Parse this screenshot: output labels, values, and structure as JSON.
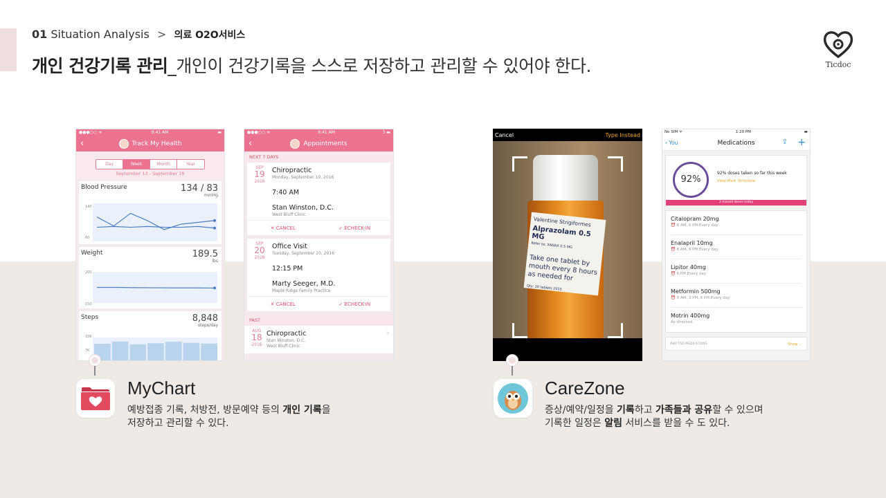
{
  "header": {
    "section_num": "01",
    "section_title": "Situation Analysis",
    "separator": ">",
    "subsection": "의료 O2O서비스",
    "headline_bold": "개인 건강기록 관리",
    "headline_underscore": "_",
    "headline_rest": "개인이 건강기록을 스스로 저장하고 관리할 수 있어야 한다.",
    "logo_text": "Ticdoc"
  },
  "mychart_screen1": {
    "status_left": "●●●○○ ᯤ",
    "status_time": "9:41 AM",
    "status_right": "▬",
    "title": "Track My Health",
    "segments": [
      "Day",
      "Week",
      "Month",
      "Year"
    ],
    "active_segment": 1,
    "range": "September 13 - September 19",
    "cards": [
      {
        "title": "Blood Pressure",
        "value": "134 / 83",
        "unit": "mmHg",
        "axis": [
          "140",
          "60"
        ]
      },
      {
        "title": "Weight",
        "value": "189.5",
        "unit": "lbs",
        "axis": [
          "200",
          "150"
        ]
      },
      {
        "title": "Steps",
        "value": "8,848",
        "unit": "steps/day",
        "axis": [
          "10K",
          "7K"
        ]
      }
    ],
    "bp_series": [
      {
        "name": "systolic",
        "values": [
          140,
          135,
          142,
          138,
          133,
          136,
          137,
          138
        ]
      },
      {
        "name": "diastolic",
        "values": [
          84,
          85,
          84,
          85,
          84,
          84,
          85,
          83
        ]
      }
    ],
    "weight_values": [
      190,
      190,
      189.8,
      189.7,
      189.6,
      189.6,
      189.5
    ],
    "steps_values": [
      8800,
      9600,
      8600,
      9000,
      9500,
      9100,
      8848
    ]
  },
  "mychart_screen2": {
    "status_left": "●●●○○ ᯤ",
    "status_time": "9:41 AM",
    "status_right": "3 ▬",
    "title": "Appointments",
    "next_header": "NEXT 7 DAYS",
    "appointments": [
      {
        "month": "SEP",
        "day": "19",
        "year": "2016",
        "title": "Chiropractic",
        "date": "Monday, September 19, 2016",
        "time": "7:40 AM",
        "doctor": "Stan Winston, D.C.",
        "location": "West Bluff Clinic",
        "cancel": "CANCEL",
        "checkin": "ECHECK-IN"
      },
      {
        "month": "SEP",
        "day": "20",
        "year": "2016",
        "title": "Office Visit",
        "date": "Tuesday, September 20, 2016",
        "time": "12:15 PM",
        "doctor": "Marty Seeger, M.D.",
        "location": "Maple Ridge Family Practice",
        "cancel": "CANCEL",
        "checkin": "ECHECK-IN"
      }
    ],
    "past_header": "PAST",
    "past": {
      "month": "AUG",
      "day": "18",
      "year": "2016",
      "title": "Chiropractic",
      "doctor": "Stan Winston, D.C.",
      "location": "West Bluff Clinic"
    }
  },
  "carezone_screen1": {
    "cancel": "Cancel",
    "type_instead": "Type Instead",
    "label_line1": "Valentine Strigiformes",
    "label_drug": "Alprazolam 0.5 MG",
    "label_small": "Refer to: XANAX 0.5 MG",
    "label_instr": "Take one tablet by mouth every 8 hours as needed for",
    "label_qty": "Qty: 30 tablets 2015"
  },
  "carezone_screen2": {
    "status_left": "No SIM ᯤ",
    "status_time": "1:20 PM",
    "status_right": "▬",
    "back": "You",
    "title": "Medications",
    "percent": "92%",
    "dose_text": "92% doses taken so far this week",
    "view_med": "View Med",
    "schedule": "Schedule",
    "missed": "2 missed doses today",
    "meds": [
      {
        "name": "Citalopram 20mg",
        "sched": "8 AM, 6 PM Every day"
      },
      {
        "name": "Enalapril 10mg",
        "sched": "8 AM, 6 PM Every day"
      },
      {
        "name": "Lipitor 40mg",
        "sched": "6 PM Every day"
      },
      {
        "name": "Metformin 500mg",
        "sched": "8 AM, 3 PM, 6 PM Every day"
      },
      {
        "name": "Motrin 400mg",
        "sched": "As directed."
      }
    ],
    "inactive": "INACTIVE MEDICATIONS",
    "show": "Show"
  },
  "apps": [
    {
      "name": "MyChart",
      "desc_line1_a": "예방접종 기록, 처방전, 방문예약 등의 ",
      "desc_line1_b": "개인 기록",
      "desc_line1_c": "을",
      "desc_line2": "저장하고 관리할 수 있다."
    },
    {
      "name": "CareZone",
      "desc_line1_a": "증상/예약/일정을 ",
      "desc_line1_b": "기록",
      "desc_line1_c": "하고 ",
      "desc_line1_d": "가족들과 공유",
      "desc_line1_e": "할 수 있으며",
      "desc_line2_a": "기록한 일정은 ",
      "desc_line2_b": "알림",
      "desc_line2_c": " 서비스를 받을 수 도 있다."
    }
  ],
  "colors": {
    "mychart_pink": "#ec7390",
    "accent_light": "#f0dfe0",
    "carezone_purple": "#6a4c9c",
    "carezone_orange": "#f1a52c",
    "bottom_bg": "#efeae6"
  }
}
